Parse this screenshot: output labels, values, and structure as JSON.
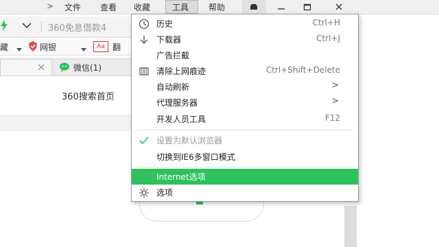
{
  "menubar": {
    "chevron": ">",
    "items": [
      "文件",
      "查看",
      "收藏",
      "工具",
      "帮助"
    ]
  },
  "address": {
    "text": "360免息借款4"
  },
  "bookmarks": {
    "item1": "网银",
    "item2": "翻"
  },
  "tabs": [
    {
      "label": ""
    },
    {
      "label": "微信(1)"
    }
  ],
  "page": {
    "heading": "360搜索首页"
  },
  "tools_menu": {
    "items": [
      {
        "label": "历史",
        "shortcut": "Ctrl+H"
      },
      {
        "label": "下载器",
        "shortcut": "Ctrl+J"
      },
      {
        "label": "广告拦截",
        "shortcut": ""
      },
      {
        "label": "清除上网痕迹",
        "shortcut": "Ctrl+Shift+Delete"
      },
      {
        "label": "自动刷新",
        "shortcut": ""
      },
      {
        "label": "代理服务器",
        "shortcut": ""
      },
      {
        "label": "开发人员工具",
        "shortcut": "F12"
      },
      {
        "label": "设置为默认浏览器",
        "shortcut": ""
      },
      {
        "label": "切换到IE6多窗口模式",
        "shortcut": ""
      },
      {
        "label": "Internet选项",
        "shortcut": ""
      },
      {
        "label": "选项",
        "shortcut": ""
      }
    ],
    "highlight_color": "#2ec15c"
  },
  "colors": {
    "accent_green": "#2ec15c",
    "check_green": "#2ec15c"
  }
}
